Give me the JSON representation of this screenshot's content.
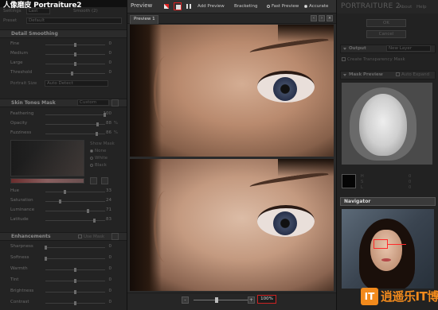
{
  "left_panel": {
    "title": "人像磨皮 Portraiture2",
    "settings_label": "Settings",
    "settings_value": "Last",
    "settings_suffix": "Smooth (2)",
    "preset_label": "Preset",
    "preset_value": "Default",
    "detail_smoothing": {
      "title": "Detail Smoothing",
      "sliders": [
        {
          "name": "Fine",
          "value": "0",
          "level": 0.5
        },
        {
          "name": "Medium",
          "value": "0",
          "level": 0.5
        },
        {
          "name": "Large",
          "value": "0",
          "level": 0.5
        },
        {
          "name": "Threshold",
          "value": "0",
          "level": 0.45
        }
      ],
      "portrait_size_label": "Portrait Size",
      "portrait_size_value": "Auto Detect"
    },
    "skin_tones_mask": {
      "title": "Skin Tones Mask",
      "mode_value": "Custom",
      "sliders": [
        {
          "name": "Feathering",
          "value": "100",
          "pct": "",
          "level": 1.0
        },
        {
          "name": "Opacity",
          "value": "88",
          "pct": "%",
          "level": 0.88
        },
        {
          "name": "Fuzziness",
          "value": "86",
          "pct": "%",
          "level": 0.86
        }
      ],
      "show_mask_label": "Show Mask",
      "show_mask_options": [
        "None",
        "White",
        "Black"
      ],
      "show_mask_selected": "None",
      "sliders2": [
        {
          "name": "Hue",
          "value": "33",
          "level": 0.33
        },
        {
          "name": "Saturation",
          "value": "24",
          "level": 0.24
        },
        {
          "name": "Luminance",
          "value": "71",
          "level": 0.71
        },
        {
          "name": "Latitude",
          "value": "83",
          "level": 0.83
        }
      ]
    },
    "enhancements": {
      "title": "Enhancements",
      "use_mask_label": "Use Mask",
      "sliders": [
        {
          "name": "Sharpness",
          "value": "0",
          "level": 0.0
        },
        {
          "name": "Softness",
          "value": "0",
          "level": 0.0
        },
        {
          "name": "Warmth",
          "value": "0",
          "level": 0.5
        },
        {
          "name": "Tint",
          "value": "0",
          "level": 0.5
        },
        {
          "name": "Brightness",
          "value": "0",
          "level": 0.5
        },
        {
          "name": "Contrast",
          "value": "0",
          "level": 0.5
        }
      ]
    }
  },
  "center": {
    "title": "Preview",
    "toolbar": {
      "add_preview": "Add Preview",
      "bracketing": "Bracketing",
      "fast_preview": "Fast Preview",
      "accurate": "Accurate",
      "selected_mode": "Accurate"
    },
    "tab": "Preview 1",
    "zoom_minus": "-",
    "zoom_plus": "+",
    "zoom_value": "100%"
  },
  "right_panel": {
    "brand": "PORTRAITURE 2",
    "about": "About",
    "help": "Help",
    "ok": "OK",
    "cancel": "Cancel",
    "output_title": "Output",
    "output_value": "New Layer",
    "create_transparency_mask": "Create Transparency Mask",
    "mask_preview_title": "Mask Preview",
    "auto_expand": "Auto Expand",
    "hsl_labels": [
      "H",
      "S",
      "L"
    ],
    "hsl_values": [
      "0",
      "0",
      "0"
    ],
    "navigator_title": "Navigator"
  },
  "watermark": {
    "badge": "IT",
    "text": "逍遥乐IT博客"
  },
  "colors": {
    "accent_red": "#dd2222",
    "watermark_orange": "#f28a1c"
  }
}
